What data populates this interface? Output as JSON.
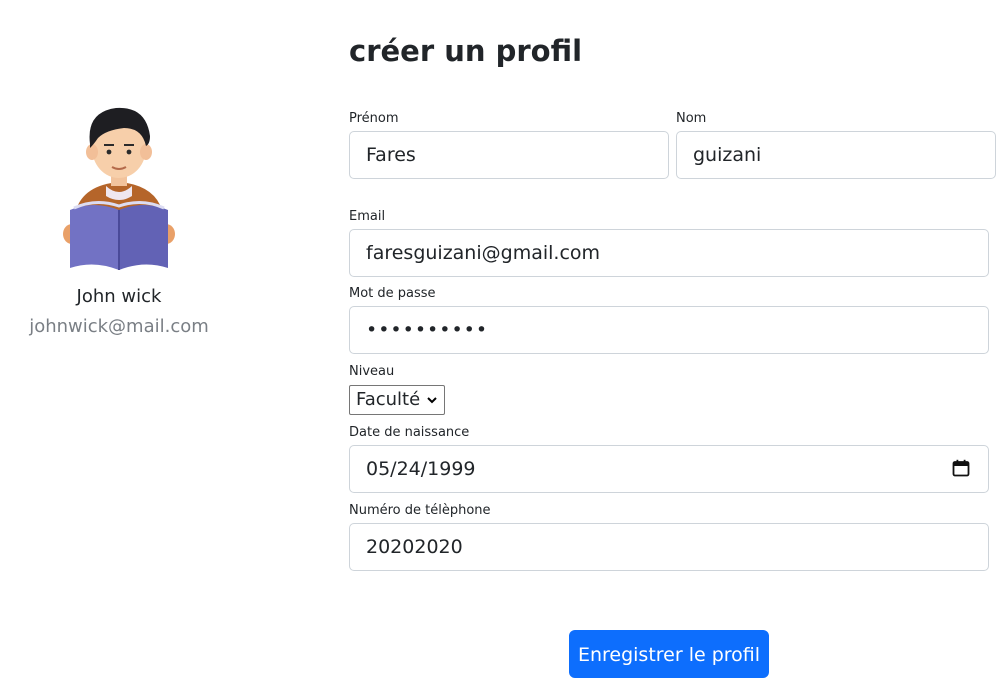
{
  "profile": {
    "name": "John wick",
    "email": "johnwick@mail.com"
  },
  "form": {
    "title": "créer un profil",
    "prenom": {
      "label": "Prénom",
      "value": "Fares"
    },
    "nom": {
      "label": "Nom",
      "value": "guizani"
    },
    "email": {
      "label": "Email",
      "value": "faresguizani@gmail.com"
    },
    "password": {
      "label": "Mot de passe",
      "value": "••••••••••"
    },
    "niveau": {
      "label": "Niveau",
      "value": "Faculté"
    },
    "date_naissance": {
      "label": "Date de naissance",
      "value": "05/24/1999"
    },
    "telephone": {
      "label": "Numéro de télèphone",
      "value": "20202020"
    },
    "submit_label": "Enregistrer le profil"
  },
  "colors": {
    "primary": "#0d6efd",
    "border": "#ced4da",
    "muted_text": "#7a7f85"
  },
  "icons": {
    "avatar": "reading-person-avatar",
    "date": "calendar-icon",
    "select": "chevron-down-icon"
  }
}
